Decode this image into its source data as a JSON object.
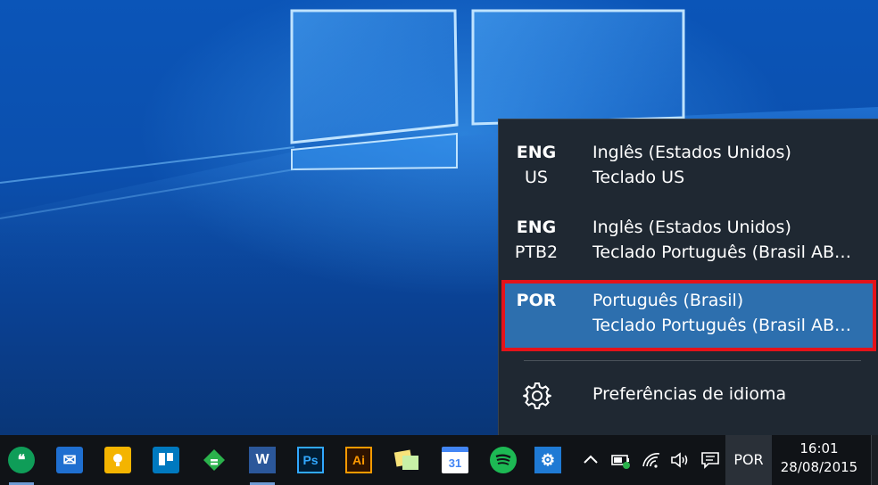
{
  "language_flyout": {
    "items": [
      {
        "code": "ENG",
        "sub": "US",
        "language": "Inglês (Estados Unidos)",
        "keyboard": "Teclado US",
        "selected": false
      },
      {
        "code": "ENG",
        "sub": "PTB2",
        "language": "Inglês (Estados Unidos)",
        "keyboard": "Teclado Português (Brasil AB…",
        "selected": false
      },
      {
        "code": "POR",
        "sub": "",
        "language": "Português (Brasil)",
        "keyboard": "Teclado Português (Brasil AB…",
        "selected": true
      }
    ],
    "preferences_label": "Preferências de idioma",
    "highlight_color": "#e4131a",
    "selected_color": "#2d6fae"
  },
  "taskbar": {
    "apps": [
      {
        "name": "hangouts-icon",
        "glyph": "❝"
      },
      {
        "name": "mail-icon",
        "glyph": "✉"
      },
      {
        "name": "keep-icon",
        "glyph": "💡"
      },
      {
        "name": "trello-icon",
        "glyph": ""
      },
      {
        "name": "feedly-icon",
        "glyph": ""
      },
      {
        "name": "word-icon",
        "glyph": "W"
      },
      {
        "name": "photoshop-icon",
        "glyph": "Ps"
      },
      {
        "name": "illustrator-icon",
        "glyph": "Ai"
      },
      {
        "name": "sticky-notes-icon",
        "glyph": ""
      },
      {
        "name": "calendar-icon",
        "glyph": "31"
      },
      {
        "name": "spotify-icon",
        "glyph": ""
      },
      {
        "name": "settings-icon",
        "glyph": "⚙"
      }
    ],
    "tray": {
      "language": "POR",
      "time": "16:01",
      "date": "28/08/2015"
    }
  }
}
